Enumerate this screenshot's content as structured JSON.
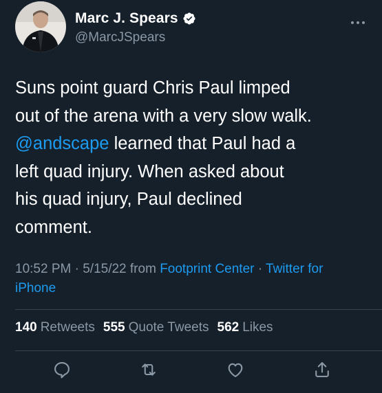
{
  "author": {
    "display_name": "Marc J. Spears",
    "handle": "@MarcJSpears",
    "verified": true
  },
  "tweet": {
    "text_before_mention": "Suns point guard Chris Paul limped\nout of the arena with a very slow walk.\n",
    "mention": "@andscape",
    "text_after_mention": " learned that Paul had a\nleft quad injury. When asked about\nhis quad injury, Paul declined\ncomment."
  },
  "meta": {
    "time": "10:52 PM",
    "separator": " · ",
    "date": "5/15/22",
    "from_label": " from ",
    "location": "Footprint Center",
    "source": "Twitter for iPhone"
  },
  "stats": {
    "retweets_count": "140",
    "retweets_label": "Retweets",
    "quotes_count": "555",
    "quotes_label": "Quote Tweets",
    "likes_count": "562",
    "likes_label": "Likes"
  },
  "colors": {
    "background": "#15202b",
    "accent": "#1d9bf0",
    "muted": "#8b98a5",
    "divider": "#38444d"
  },
  "icons": [
    "verified-badge-icon",
    "more-icon",
    "reply-icon",
    "retweet-icon",
    "like-icon",
    "share-icon"
  ]
}
